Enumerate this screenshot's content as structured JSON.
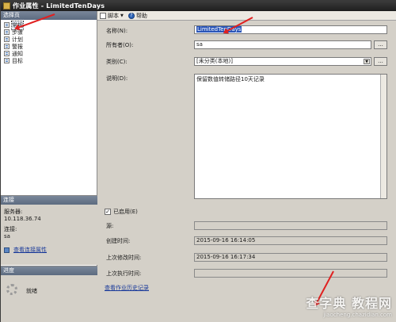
{
  "window": {
    "title": "作业属性 - LimitedTenDays"
  },
  "sidebar": {
    "pages_header": "选择页",
    "pages": [
      "常规",
      "步骤",
      "计划",
      "警报",
      "通知",
      "目标"
    ],
    "connection_header": "连接",
    "server_label": "服务器:",
    "server_value": "10.118.36.74",
    "conn_label": "连接:",
    "conn_value": "sa",
    "view_conn_link": "查看连接属性",
    "progress_header": "进度",
    "progress_status": "就绪"
  },
  "toolbar": {
    "script_label": "脚本",
    "help_label": "帮助"
  },
  "form": {
    "name_label": "名称(N):",
    "name_value": "LimitedTenDays",
    "owner_label": "所有者(O):",
    "owner_value": "sa",
    "category_label": "类别(C):",
    "category_value": "[未分类(本地)]",
    "description_label": "说明(D):",
    "description_value": "保留数值转储路径10天记录",
    "enabled_label": "已启用(E)",
    "source_label": "源:",
    "source_value": "",
    "created_label": "创建时间:",
    "created_value": "2015-09-16  16:14:05",
    "modified_label": "上次修改时间:",
    "modified_value": "2015-09-16  16:17:34",
    "last_exec_label": "上次执行时间:",
    "last_exec_value": "",
    "history_link": "查看作业历史记录",
    "dots_label": "..."
  },
  "watermark": {
    "main": "查字典 教程网",
    "sub": "jiaocheng.chazidian.com"
  },
  "colors": {
    "annotation": "#e02020",
    "link": "#1a3a9a",
    "selection": "#2a55b8"
  }
}
